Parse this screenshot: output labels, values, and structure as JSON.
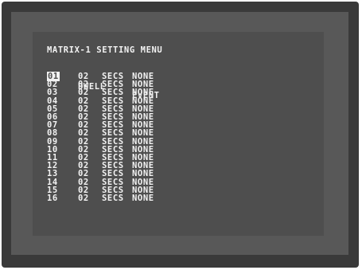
{
  "menu": {
    "title": "MATRIX-1 SETTING MENU",
    "headers": {
      "ch": "CH",
      "dwell": "DWELL",
      "event": "EVENT"
    },
    "rows": [
      {
        "ch": "01",
        "dwell": "02",
        "unit": "SECS",
        "event": "NONE"
      },
      {
        "ch": "02",
        "dwell": "02",
        "unit": "SECS",
        "event": "NONE"
      },
      {
        "ch": "03",
        "dwell": "02",
        "unit": "SECS",
        "event": "NONE"
      },
      {
        "ch": "04",
        "dwell": "02",
        "unit": "SECS",
        "event": "NONE"
      },
      {
        "ch": "05",
        "dwell": "02",
        "unit": "SECS",
        "event": "NONE"
      },
      {
        "ch": "06",
        "dwell": "02",
        "unit": "SECS",
        "event": "NONE"
      },
      {
        "ch": "07",
        "dwell": "02",
        "unit": "SECS",
        "event": "NONE"
      },
      {
        "ch": "08",
        "dwell": "02",
        "unit": "SECS",
        "event": "NONE"
      },
      {
        "ch": "09",
        "dwell": "02",
        "unit": "SECS",
        "event": "NONE"
      },
      {
        "ch": "10",
        "dwell": "02",
        "unit": "SECS",
        "event": "NONE"
      },
      {
        "ch": "11",
        "dwell": "02",
        "unit": "SECS",
        "event": "NONE"
      },
      {
        "ch": "12",
        "dwell": "02",
        "unit": "SECS",
        "event": "NONE"
      },
      {
        "ch": "13",
        "dwell": "02",
        "unit": "SECS",
        "event": "NONE"
      },
      {
        "ch": "14",
        "dwell": "02",
        "unit": "SECS",
        "event": "NONE"
      },
      {
        "ch": "15",
        "dwell": "02",
        "unit": "SECS",
        "event": "NONE"
      },
      {
        "ch": "16",
        "dwell": "02",
        "unit": "SECS",
        "event": "NONE"
      }
    ],
    "selected_channel": "01"
  },
  "colors": {
    "outer_frame": "#3a3a3a",
    "bezel": "#585858",
    "screen": "#4e4e4e",
    "text": "#f2f2f2"
  }
}
